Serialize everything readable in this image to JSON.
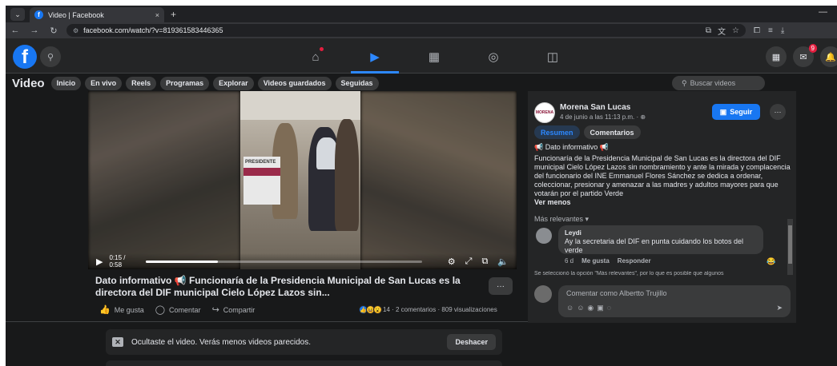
{
  "browser": {
    "tab_title": "Video | Facebook",
    "tab_close": "×",
    "new_tab": "+",
    "url": "facebook.com/watch/?v=819361583446365"
  },
  "fb": {
    "logo": "f",
    "notification_count": "9"
  },
  "video_header": {
    "title": "Video",
    "pills": [
      "Inicio",
      "En vivo",
      "Reels",
      "Programas",
      "Explorar",
      "Videos guardados",
      "Seguidas"
    ],
    "search_placeholder": "Buscar videos"
  },
  "player": {
    "time": "0:15 / 0:58",
    "progress": 0.26,
    "box_label": "PRESIDENTE"
  },
  "video_title": {
    "emoji": "📢",
    "text": "Dato informativo 📢 Funcionaría de la Presidencia Municipal de San Lucas es la directora del DIF municipal Cielo López Lazos sin..."
  },
  "actions": {
    "like": "Me gusta",
    "comment": "Comentar",
    "share": "Compartir"
  },
  "stats": {
    "text": "14 · 2 comentarios · 809 visualizaciones"
  },
  "hidden_notice": {
    "message": "Ocultaste el video. Verás menos videos parecidos.",
    "undo": "Deshacer"
  },
  "post": {
    "page_name": "Morena San Lucas",
    "date": "4 de junio a las 11:13 p.m. · ",
    "follow": "Seguir",
    "tabs": [
      "Resumen",
      "Comentarios"
    ],
    "header": "📢 Dato informativo 📢",
    "body": "Funcionaría de la Presidencia Municipal de San Lucas es la directora del DIF municipal Cielo López Lazos sin nombramiento y ante la mirada y complacencia del funcionario del INE Emmanuel Flores Sánchez se dedica a ordenar, coleccionar, presionar y amenazar a las madres y adultos mayores para que votarán por el partido Verde",
    "see_more": "Ver menos",
    "sort": "Más relevantes ▾",
    "avatar_text": "MORENA"
  },
  "comment": {
    "author": "Leydi",
    "text": "Ay la secretaria del DIF en punta cuidando los botos del verde",
    "age": "6 d",
    "like": "Me gusta",
    "reply": "Responder",
    "reaction": "😂"
  },
  "note": "Se seleccionó la opción \"Más relevantes\", por lo que es posible que algunos",
  "composer": {
    "placeholder": "Comentar como Albertto Trujillo",
    "send": "➤"
  }
}
